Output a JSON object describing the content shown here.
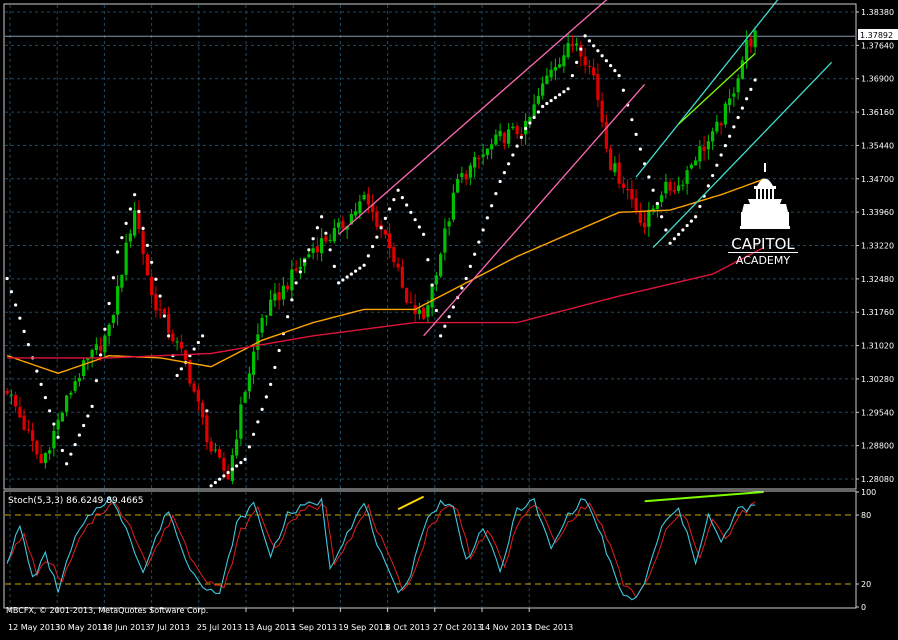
{
  "chart_data": [
    {
      "type": "candlestick",
      "title": "",
      "price_label": "1.37892",
      "y_ticks": [
        "1.38380",
        "1.37640",
        "1.36900",
        "1.36160",
        "1.35440",
        "1.34700",
        "1.33960",
        "1.33220",
        "1.32480",
        "1.31760",
        "1.31020",
        "1.30280",
        "1.29540",
        "1.28800",
        "1.28080"
      ],
      "ylim": [
        1.2765,
        1.386
      ],
      "x_ticks": [
        "12 May 2013",
        "30 May 2013",
        "18 Jun 2013",
        "7 Jul 2013",
        "25 Jul 2013",
        "13 Aug 2013",
        "1 Sep 2013",
        "19 Sep 2013",
        "8 Oct 2013",
        "27 Oct 2013",
        "14 Nov 2013",
        "3 Dec 2013"
      ],
      "grid": true,
      "ohlc_keypoints": [
        {
          "i": 0,
          "v": 1.299
        },
        {
          "i": 8,
          "v": 1.282
        },
        {
          "i": 16,
          "v": 1.301
        },
        {
          "i": 24,
          "v": 1.312
        },
        {
          "i": 30,
          "v": 1.34
        },
        {
          "i": 34,
          "v": 1.32
        },
        {
          "i": 42,
          "v": 1.305
        },
        {
          "i": 48,
          "v": 1.285
        },
        {
          "i": 52,
          "v": 1.279
        },
        {
          "i": 56,
          "v": 1.299
        },
        {
          "i": 60,
          "v": 1.315
        },
        {
          "i": 66,
          "v": 1.323
        },
        {
          "i": 72,
          "v": 1.331
        },
        {
          "i": 78,
          "v": 1.335
        },
        {
          "i": 84,
          "v": 1.342
        },
        {
          "i": 90,
          "v": 1.332
        },
        {
          "i": 94,
          "v": 1.318
        },
        {
          "i": 98,
          "v": 1.315
        },
        {
          "i": 102,
          "v": 1.33
        },
        {
          "i": 106,
          "v": 1.346
        },
        {
          "i": 110,
          "v": 1.35
        },
        {
          "i": 116,
          "v": 1.356
        },
        {
          "i": 122,
          "v": 1.358
        },
        {
          "i": 128,
          "v": 1.372
        },
        {
          "i": 134,
          "v": 1.378
        },
        {
          "i": 138,
          "v": 1.37
        },
        {
          "i": 142,
          "v": 1.35
        },
        {
          "i": 146,
          "v": 1.344
        },
        {
          "i": 150,
          "v": 1.336
        },
        {
          "i": 154,
          "v": 1.344
        },
        {
          "i": 158,
          "v": 1.345
        },
        {
          "i": 162,
          "v": 1.352
        },
        {
          "i": 166,
          "v": 1.356
        },
        {
          "i": 170,
          "v": 1.364
        },
        {
          "i": 174,
          "v": 1.377
        },
        {
          "i": 176,
          "v": 1.379
        }
      ],
      "sar_keypoints": [
        {
          "i": 0,
          "v": 1.324
        },
        {
          "i": 6,
          "v": 1.306
        },
        {
          "i": 14,
          "v": 1.282
        },
        {
          "i": 20,
          "v": 1.295
        },
        {
          "i": 26,
          "v": 1.33
        },
        {
          "i": 30,
          "v": 1.343
        },
        {
          "i": 36,
          "v": 1.32
        },
        {
          "i": 40,
          "v": 1.302
        },
        {
          "i": 46,
          "v": 1.311
        },
        {
          "i": 48,
          "v": 1.277
        },
        {
          "i": 56,
          "v": 1.283
        },
        {
          "i": 62,
          "v": 1.3
        },
        {
          "i": 68,
          "v": 1.323
        },
        {
          "i": 74,
          "v": 1.338
        },
        {
          "i": 78,
          "v": 1.323
        },
        {
          "i": 84,
          "v": 1.327
        },
        {
          "i": 92,
          "v": 1.344
        },
        {
          "i": 98,
          "v": 1.334
        },
        {
          "i": 102,
          "v": 1.311
        },
        {
          "i": 108,
          "v": 1.324
        },
        {
          "i": 116,
          "v": 1.346
        },
        {
          "i": 122,
          "v": 1.358
        },
        {
          "i": 126,
          "v": 1.363
        },
        {
          "i": 132,
          "v": 1.367
        },
        {
          "i": 136,
          "v": 1.379
        },
        {
          "i": 144,
          "v": 1.37
        },
        {
          "i": 150,
          "v": 1.35
        },
        {
          "i": 156,
          "v": 1.332
        },
        {
          "i": 162,
          "v": 1.338
        },
        {
          "i": 168,
          "v": 1.352
        },
        {
          "i": 176,
          "v": 1.369
        }
      ],
      "ma_orange": [
        {
          "i": 0,
          "v": 1.3065
        },
        {
          "i": 12,
          "v": 1.3025
        },
        {
          "i": 24,
          "v": 1.3065
        },
        {
          "i": 36,
          "v": 1.306
        },
        {
          "i": 48,
          "v": 1.304
        },
        {
          "i": 60,
          "v": 1.31
        },
        {
          "i": 72,
          "v": 1.314
        },
        {
          "i": 84,
          "v": 1.317
        },
        {
          "i": 96,
          "v": 1.317
        },
        {
          "i": 108,
          "v": 1.323
        },
        {
          "i": 120,
          "v": 1.329
        },
        {
          "i": 132,
          "v": 1.334
        },
        {
          "i": 144,
          "v": 1.339
        },
        {
          "i": 156,
          "v": 1.3395
        },
        {
          "i": 168,
          "v": 1.343
        },
        {
          "i": 178,
          "v": 1.3465
        }
      ],
      "ma_red": [
        {
          "i": 0,
          "v": 1.306
        },
        {
          "i": 24,
          "v": 1.306
        },
        {
          "i": 48,
          "v": 1.307
        },
        {
          "i": 72,
          "v": 1.311
        },
        {
          "i": 96,
          "v": 1.314
        },
        {
          "i": 120,
          "v": 1.314
        },
        {
          "i": 144,
          "v": 1.32
        },
        {
          "i": 166,
          "v": 1.325
        },
        {
          "i": 178,
          "v": 1.331
        }
      ],
      "annotations": [
        {
          "color": "#ff69b4",
          "from": {
            "i": 78,
            "v": 1.334
          },
          "to": {
            "i": 142,
            "v": 1.388
          }
        },
        {
          "color": "#ff69b4",
          "from": {
            "i": 98,
            "v": 1.311
          },
          "to": {
            "i": 150,
            "v": 1.368
          }
        },
        {
          "color": "#40e0d0",
          "from": {
            "i": 148,
            "v": 1.347
          },
          "to": {
            "i": 182,
            "v": 1.388
          }
        },
        {
          "color": "#40e0d0",
          "from": {
            "i": 152,
            "v": 1.331
          },
          "to": {
            "i": 194,
            "v": 1.373
          }
        },
        {
          "color": "#7cfc00",
          "from": {
            "i": 158,
            "v": 1.359
          },
          "to": {
            "i": 176,
            "v": 1.375
          }
        }
      ]
    },
    {
      "type": "line",
      "title": "Stoch(5,3,3) 86.6249 89.4665",
      "y_ticks": [
        "100",
        "80",
        "20",
        "0"
      ],
      "ylim": [
        0,
        100
      ],
      "levels": [
        80,
        20
      ],
      "series": [],
      "main_keypoints": [
        {
          "i": 0,
          "v": 40
        },
        {
          "i": 3,
          "v": 70
        },
        {
          "i": 6,
          "v": 25
        },
        {
          "i": 9,
          "v": 45
        },
        {
          "i": 12,
          "v": 15
        },
        {
          "i": 16,
          "v": 60
        },
        {
          "i": 20,
          "v": 82
        },
        {
          "i": 24,
          "v": 95
        },
        {
          "i": 28,
          "v": 70
        },
        {
          "i": 32,
          "v": 30
        },
        {
          "i": 35,
          "v": 60
        },
        {
          "i": 38,
          "v": 85
        },
        {
          "i": 42,
          "v": 40
        },
        {
          "i": 46,
          "v": 20
        },
        {
          "i": 50,
          "v": 10
        },
        {
          "i": 54,
          "v": 72
        },
        {
          "i": 58,
          "v": 90
        },
        {
          "i": 62,
          "v": 45
        },
        {
          "i": 66,
          "v": 80
        },
        {
          "i": 70,
          "v": 88
        },
        {
          "i": 74,
          "v": 92
        },
        {
          "i": 76,
          "v": 35
        },
        {
          "i": 80,
          "v": 65
        },
        {
          "i": 84,
          "v": 90
        },
        {
          "i": 88,
          "v": 45
        },
        {
          "i": 92,
          "v": 10
        },
        {
          "i": 95,
          "v": 30
        },
        {
          "i": 98,
          "v": 70
        },
        {
          "i": 102,
          "v": 92
        },
        {
          "i": 105,
          "v": 86
        },
        {
          "i": 108,
          "v": 40
        },
        {
          "i": 112,
          "v": 70
        },
        {
          "i": 116,
          "v": 30
        },
        {
          "i": 120,
          "v": 85
        },
        {
          "i": 124,
          "v": 92
        },
        {
          "i": 128,
          "v": 50
        },
        {
          "i": 132,
          "v": 80
        },
        {
          "i": 136,
          "v": 95
        },
        {
          "i": 140,
          "v": 60
        },
        {
          "i": 144,
          "v": 15
        },
        {
          "i": 147,
          "v": 5
        },
        {
          "i": 150,
          "v": 20
        },
        {
          "i": 154,
          "v": 70
        },
        {
          "i": 158,
          "v": 85
        },
        {
          "i": 162,
          "v": 40
        },
        {
          "i": 165,
          "v": 80
        },
        {
          "i": 168,
          "v": 55
        },
        {
          "i": 172,
          "v": 85
        },
        {
          "i": 176,
          "v": 86.6249
        }
      ],
      "signal_keypoints": [
        {
          "i": 0,
          "v": 42
        },
        {
          "i": 4,
          "v": 62
        },
        {
          "i": 7,
          "v": 30
        },
        {
          "i": 10,
          "v": 40
        },
        {
          "i": 13,
          "v": 22
        },
        {
          "i": 17,
          "v": 58
        },
        {
          "i": 21,
          "v": 80
        },
        {
          "i": 25,
          "v": 90
        },
        {
          "i": 29,
          "v": 72
        },
        {
          "i": 33,
          "v": 36
        },
        {
          "i": 36,
          "v": 58
        },
        {
          "i": 39,
          "v": 80
        },
        {
          "i": 43,
          "v": 45
        },
        {
          "i": 47,
          "v": 24
        },
        {
          "i": 51,
          "v": 15
        },
        {
          "i": 55,
          "v": 66
        },
        {
          "i": 59,
          "v": 86
        },
        {
          "i": 63,
          "v": 50
        },
        {
          "i": 67,
          "v": 76
        },
        {
          "i": 71,
          "v": 86
        },
        {
          "i": 75,
          "v": 88
        },
        {
          "i": 77,
          "v": 40
        },
        {
          "i": 81,
          "v": 62
        },
        {
          "i": 85,
          "v": 86
        },
        {
          "i": 89,
          "v": 50
        },
        {
          "i": 93,
          "v": 15
        },
        {
          "i": 96,
          "v": 32
        },
        {
          "i": 99,
          "v": 66
        },
        {
          "i": 103,
          "v": 88
        },
        {
          "i": 106,
          "v": 84
        },
        {
          "i": 109,
          "v": 45
        },
        {
          "i": 113,
          "v": 66
        },
        {
          "i": 117,
          "v": 36
        },
        {
          "i": 121,
          "v": 80
        },
        {
          "i": 125,
          "v": 88
        },
        {
          "i": 129,
          "v": 55
        },
        {
          "i": 133,
          "v": 78
        },
        {
          "i": 137,
          "v": 90
        },
        {
          "i": 141,
          "v": 62
        },
        {
          "i": 145,
          "v": 20
        },
        {
          "i": 148,
          "v": 10
        },
        {
          "i": 151,
          "v": 24
        },
        {
          "i": 155,
          "v": 66
        },
        {
          "i": 159,
          "v": 82
        },
        {
          "i": 163,
          "v": 45
        },
        {
          "i": 166,
          "v": 76
        },
        {
          "i": 169,
          "v": 58
        },
        {
          "i": 173,
          "v": 82
        },
        {
          "i": 176,
          "v": 89.4665
        }
      ],
      "annotations": [
        {
          "color": "#ffd700",
          "from": {
            "i": 92,
            "v": 85
          },
          "to": {
            "i": 98,
            "v": 96
          }
        },
        {
          "color": "#7cfc00",
          "from": {
            "i": 150,
            "v": 92
          },
          "to": {
            "i": 178,
            "v": 100
          }
        }
      ]
    }
  ],
  "branding": {
    "name_line1": "CAPITOL",
    "name_line2": "ACADEMY",
    "copyright": "MBCFX, © 2001-2013, MetaQuotes Software Corp."
  },
  "colors": {
    "background": "#000000",
    "grid": "#1f4a66",
    "axis": "#cccccc",
    "bull": "#00c000",
    "bear": "#e00000",
    "sar": "#ffffff",
    "ma_orange": "#ffa500",
    "ma_red": "#dc143c",
    "stoch_main": "#40c8e0",
    "stoch_signal": "#e02020",
    "level_line": "#c8a800",
    "price_line": "#8899aa"
  }
}
